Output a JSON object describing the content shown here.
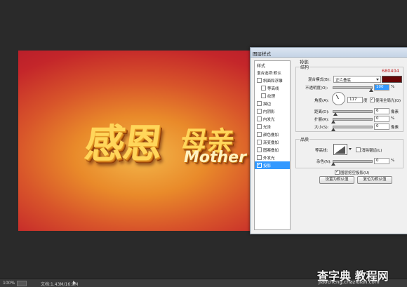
{
  "artwork": {
    "title_cn": "感恩",
    "title_cn2": "母亲",
    "title_en": "Mother"
  },
  "statusbar": {
    "zoom": "100%",
    "doc_info": "文档:1.43M/16.9M"
  },
  "dialog": {
    "title": "图层样式",
    "styles_header": "样式",
    "style_items": [
      {
        "label": "混合选项:默认",
        "checked": null
      },
      {
        "label": "斜面和浮雕",
        "checked": false
      },
      {
        "label": "等高线",
        "checked": false
      },
      {
        "label": "纹理",
        "checked": false
      },
      {
        "label": "描边",
        "checked": false
      },
      {
        "label": "内阴影",
        "checked": false
      },
      {
        "label": "内发光",
        "checked": false
      },
      {
        "label": "光泽",
        "checked": false
      },
      {
        "label": "颜色叠加",
        "checked": false
      },
      {
        "label": "渐变叠加",
        "checked": false
      },
      {
        "label": "图案叠加",
        "checked": false
      },
      {
        "label": "外发光",
        "checked": false
      },
      {
        "label": "投影",
        "checked": true
      }
    ],
    "section_title": "投影",
    "structure_label": "结构",
    "color_hex": "680404",
    "blend_mode_label": "混合模式(B):",
    "blend_mode_value": "正片叠底",
    "opacity_label": "不透明度(O):",
    "opacity_value": "100",
    "percent": "%",
    "angle_label": "角度(A):",
    "angle_value": "117",
    "degree": "度",
    "global_light_label": "使用全局光(G)",
    "global_light_checked": true,
    "distance_label": "距离(D):",
    "distance_value": "6",
    "spread_label": "扩展(R):",
    "spread_value": "0",
    "size_label": "大小(S):",
    "size_value": "0",
    "pixel_unit": "像素",
    "quality_label": "品质",
    "contour_label": "等高线:",
    "antialias_label": "消除锯齿(L)",
    "noise_label": "杂色(N):",
    "noise_value": "0",
    "knockout_label": "图层挖空投影(U)",
    "knockout_checked": true,
    "btn_set_default": "设置为默认值",
    "btn_reset_default": "复位为默认值",
    "colors": {
      "shadow": "#680404",
      "selection": "#3399ff"
    }
  },
  "watermark": {
    "cn": "查字典 教程网",
    "url": "jiaocheng.chazidian.com"
  }
}
